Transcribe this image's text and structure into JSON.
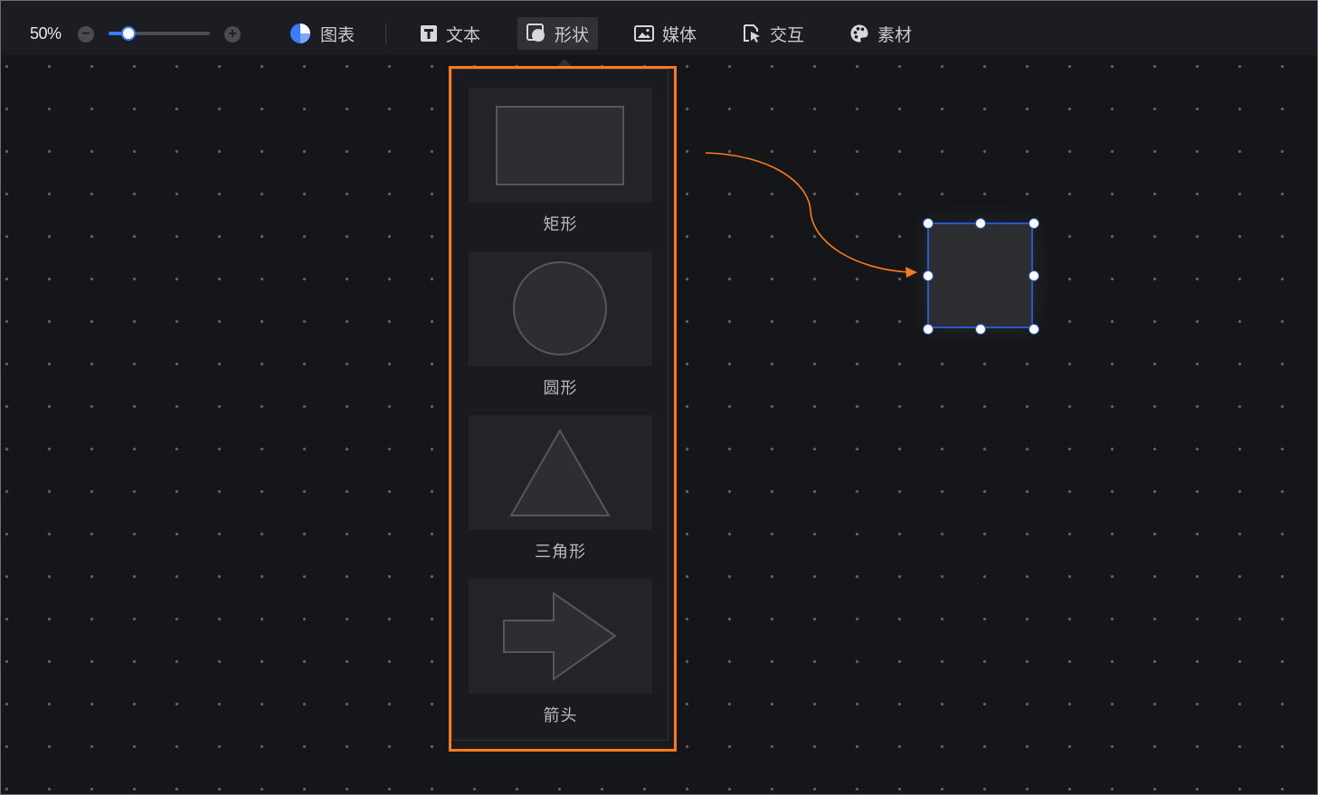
{
  "zoom": {
    "label": "50%",
    "value_percent": 50
  },
  "toolbar": {
    "items": [
      {
        "label": "图表",
        "icon": "pie-chart-icon"
      },
      {
        "label": "文本",
        "icon": "text-icon"
      },
      {
        "label": "形状",
        "icon": "shape-icon",
        "active": true
      },
      {
        "label": "媒体",
        "icon": "image-icon"
      },
      {
        "label": "交互",
        "icon": "cursor-click-icon"
      },
      {
        "label": "素材",
        "icon": "palette-icon"
      }
    ]
  },
  "shapes_panel": {
    "items": [
      {
        "label": "矩形",
        "shape": "rectangle"
      },
      {
        "label": "圆形",
        "shape": "circle"
      },
      {
        "label": "三角形",
        "shape": "triangle"
      },
      {
        "label": "箭头",
        "shape": "arrow"
      }
    ]
  },
  "colors": {
    "accent": "#3a7bff",
    "highlight": "#ff7a1a",
    "selection": "#2b58c9",
    "canvas": "#151619",
    "shape_fill": "#2c2d31"
  }
}
